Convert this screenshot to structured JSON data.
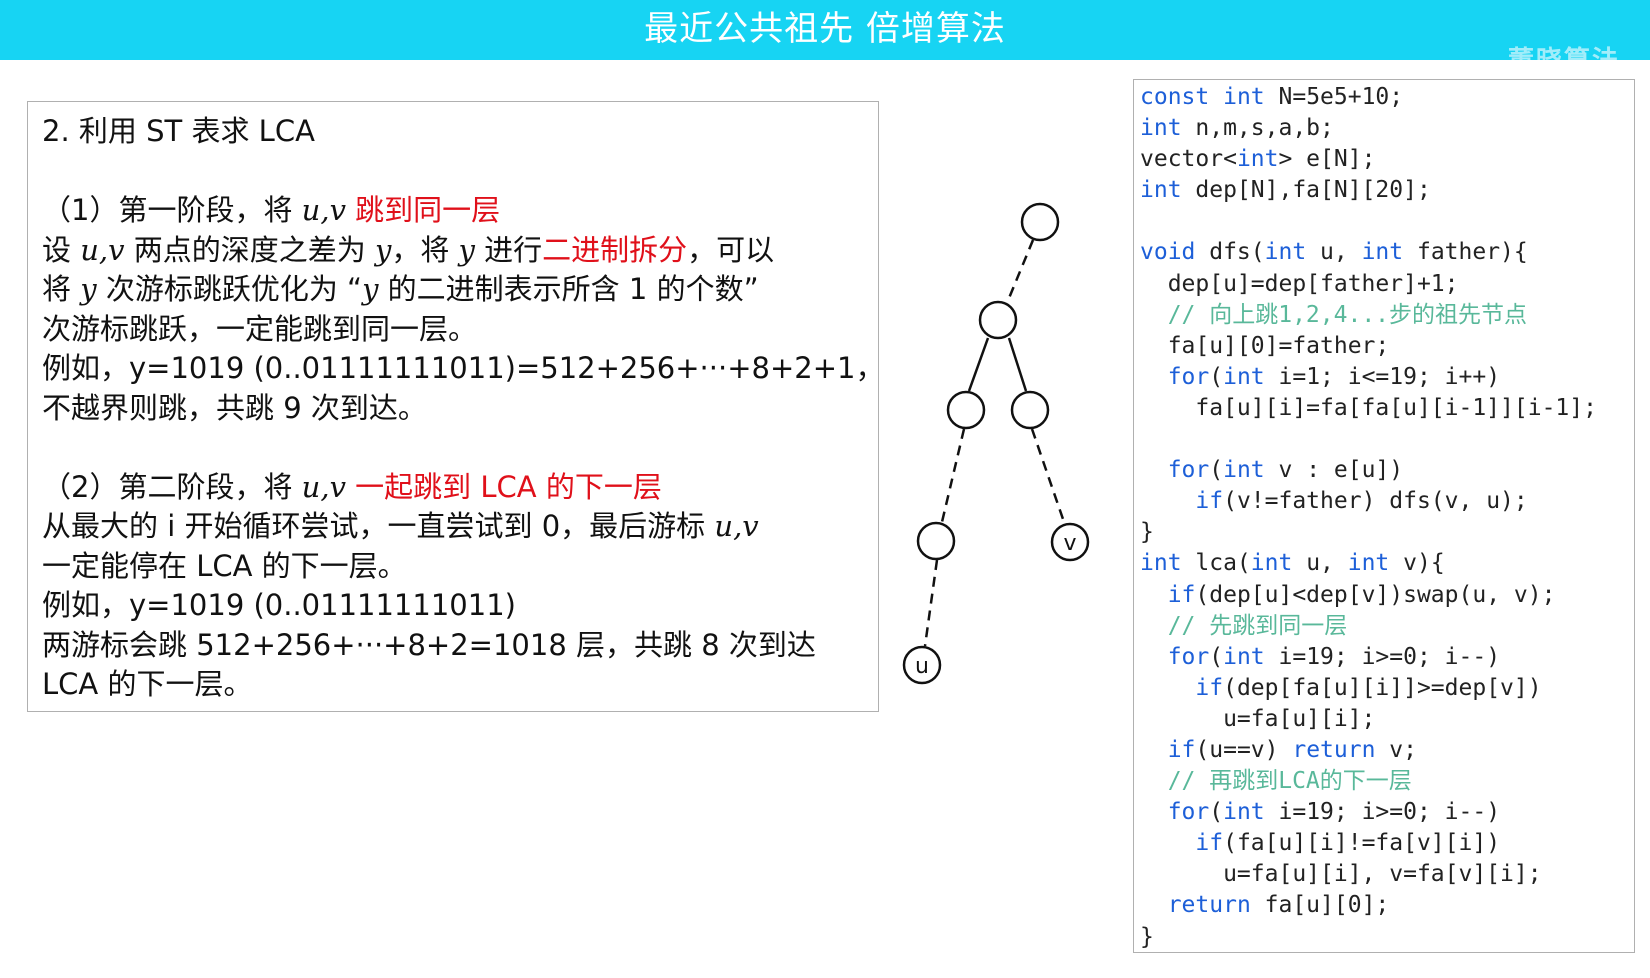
{
  "title": "最近公共祖先 倍增算法",
  "watermark": "董晓算法",
  "text_panel": {
    "heading": "2.  利用 ST 表求 LCA",
    "p1_prefix": "（1）第一阶段，将 ",
    "uv": "u,v",
    "p1_red": " 跳到同一层",
    "p1_l2_a": "设 ",
    "p1_l2_b": " 两点的深度之差为 ",
    "y": "y",
    "p1_l2_c": "，将 ",
    "p1_l2_d": " 进行",
    "p1_l2_red": "二进制拆分",
    "p1_l2_e": "，可以",
    "p1_l3_a": "将 ",
    "p1_l3_b": " 次游标跳跃优化为 “",
    "p1_l3_c": " 的二进制表示所含 1 的个数”",
    "p1_l4": "次游标跳跃，一定能跳到同一层。",
    "p1_l5": "例如，y=1019 (0..01111111011)=512+256+···+8+2+1，",
    "p1_l6": "不越界则跳，共跳 9 次到达。",
    "p2_prefix": "（2）第二阶段，将 ",
    "p2_red": " 一起跳到 LCA 的下一层",
    "p2_l2_a": "从最大的 i 开始循环尝试，一直尝试到 0，最后游标 ",
    "p2_l3": "一定能停在 LCA 的下一层。",
    "p2_l4": "例如，y=1019 (0..01111111011)",
    "p2_l5": "两游标会跳 512+256+···+8+2=1018 层，共跳 8 次到达",
    "p2_l6": "LCA 的下一层。"
  },
  "tree": {
    "label_u": "u",
    "label_v": "v"
  },
  "code_lines": [
    [
      [
        "kw",
        "const"
      ],
      [
        "",
        " "
      ],
      [
        "kw",
        "int"
      ],
      [
        "",
        " N=5e5+10;"
      ]
    ],
    [
      [
        "kw",
        "int"
      ],
      [
        "",
        " n,m,s,a,b;"
      ]
    ],
    [
      [
        "",
        "vector<"
      ],
      [
        "kw",
        "int"
      ],
      [
        "",
        "> e[N];"
      ]
    ],
    [
      [
        "kw",
        "int"
      ],
      [
        "",
        " dep[N],fa[N][20];"
      ]
    ],
    [],
    [
      [
        "kw",
        "void"
      ],
      [
        "",
        " dfs("
      ],
      [
        "kw",
        "int"
      ],
      [
        "",
        " u, "
      ],
      [
        "kw",
        "int"
      ],
      [
        "",
        " father){"
      ]
    ],
    [
      [
        "",
        "  dep[u]=dep[father]+1;"
      ]
    ],
    [
      [
        "cm",
        "  // 向上跳1,2,4...步的祖先节点"
      ]
    ],
    [
      [
        "",
        "  fa[u][0]=father;"
      ]
    ],
    [
      [
        "",
        "  "
      ],
      [
        "kw",
        "for"
      ],
      [
        "",
        "("
      ],
      [
        "kw",
        "int"
      ],
      [
        "",
        " i=1; i<=19; i++)"
      ]
    ],
    [
      [
        "",
        "    fa[u][i]=fa[fa[u][i-1]][i-1];"
      ]
    ],
    [],
    [
      [
        "",
        "  "
      ],
      [
        "kw",
        "for"
      ],
      [
        "",
        "("
      ],
      [
        "kw",
        "int"
      ],
      [
        "",
        " v : e[u])"
      ]
    ],
    [
      [
        "",
        "    "
      ],
      [
        "kw",
        "if"
      ],
      [
        "",
        "(v!=father) dfs(v, u);"
      ]
    ],
    [
      [
        "",
        "}"
      ]
    ],
    [
      [
        "kw",
        "int"
      ],
      [
        "",
        " lca("
      ],
      [
        "kw",
        "int"
      ],
      [
        "",
        " u, "
      ],
      [
        "kw",
        "int"
      ],
      [
        "",
        " v){"
      ]
    ],
    [
      [
        "",
        "  "
      ],
      [
        "kw",
        "if"
      ],
      [
        "",
        "(dep[u]<dep[v])swap(u, v);"
      ]
    ],
    [
      [
        "cm",
        "  // 先跳到同一层"
      ]
    ],
    [
      [
        "",
        "  "
      ],
      [
        "kw",
        "for"
      ],
      [
        "",
        "("
      ],
      [
        "kw",
        "int"
      ],
      [
        "",
        " i=19; i>=0; i--)"
      ]
    ],
    [
      [
        "",
        "    "
      ],
      [
        "kw",
        "if"
      ],
      [
        "",
        "(dep[fa[u][i]]>=dep[v])"
      ]
    ],
    [
      [
        "",
        "      u=fa[u][i];"
      ]
    ],
    [
      [
        "",
        "  "
      ],
      [
        "kw",
        "if"
      ],
      [
        "",
        "(u==v) "
      ],
      [
        "kw",
        "return"
      ],
      [
        "",
        " v;"
      ]
    ],
    [
      [
        "cm",
        "  // 再跳到LCA的下一层"
      ]
    ],
    [
      [
        "",
        "  "
      ],
      [
        "kw",
        "for"
      ],
      [
        "",
        "("
      ],
      [
        "kw",
        "int"
      ],
      [
        "",
        " i=19; i>=0; i--)"
      ]
    ],
    [
      [
        "",
        "    "
      ],
      [
        "kw",
        "if"
      ],
      [
        "",
        "(fa[u][i]!=fa[v][i])"
      ]
    ],
    [
      [
        "",
        "      u=fa[u][i], v=fa[v][i];"
      ]
    ],
    [
      [
        "",
        "  "
      ],
      [
        "kw",
        "return"
      ],
      [
        "",
        " fa[u][0];"
      ]
    ],
    [
      [
        "",
        "}"
      ]
    ]
  ]
}
